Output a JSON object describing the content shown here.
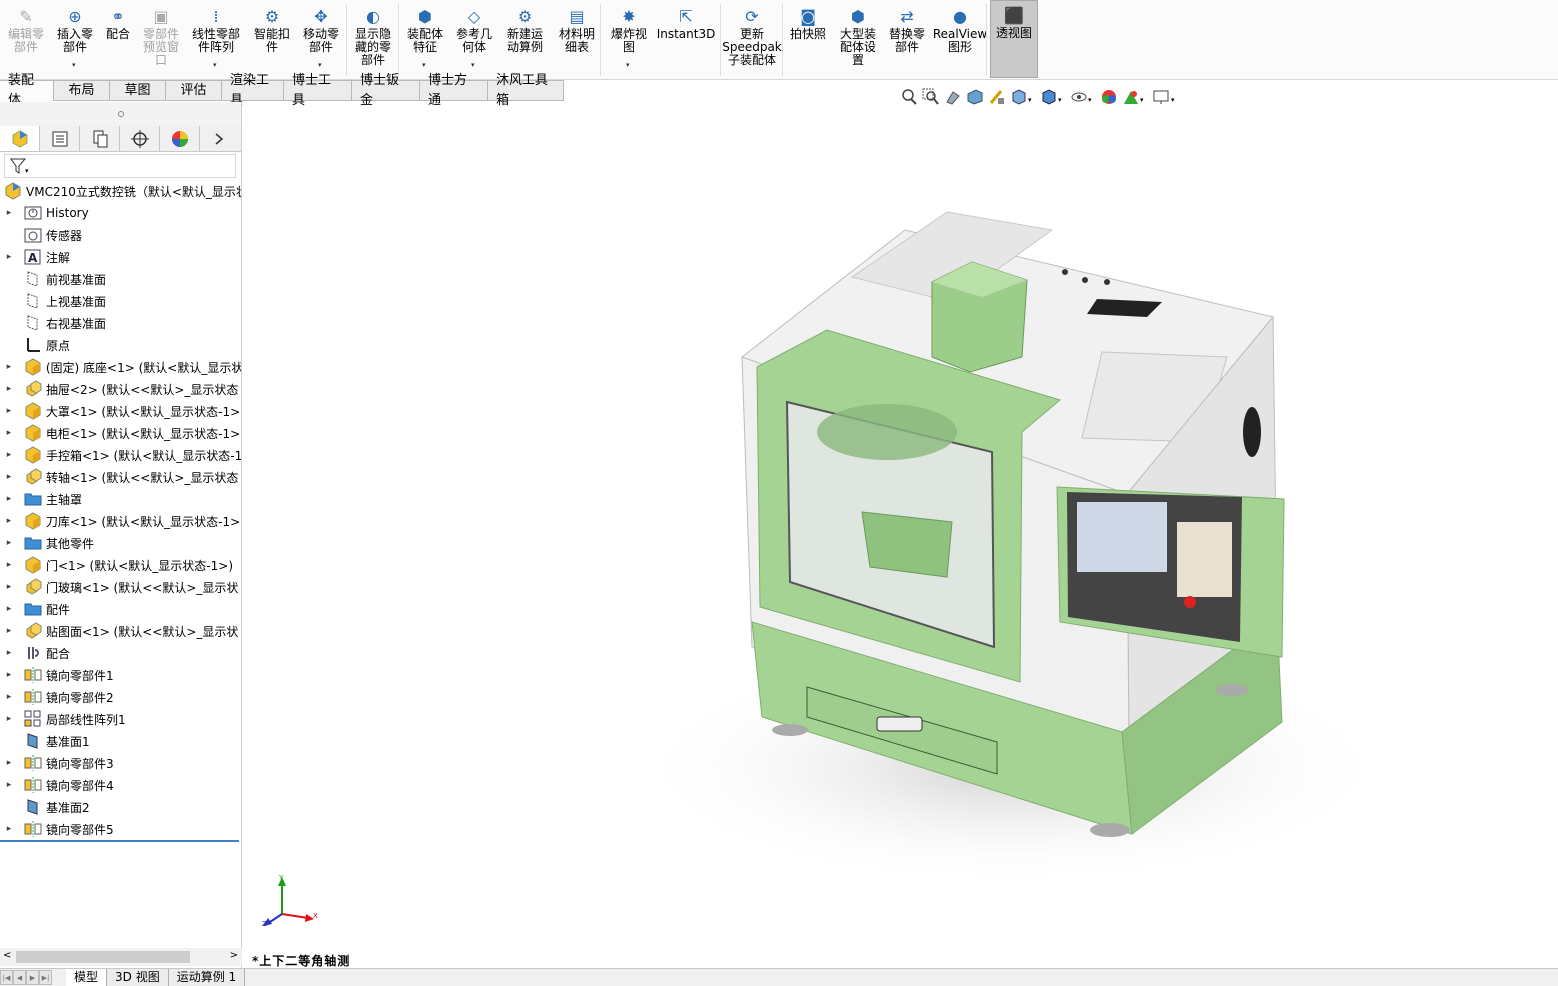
{
  "ribbon": {
    "buttons": [
      {
        "label": "编辑零\n部件",
        "disabled": true
      },
      {
        "label": "插入零\n部件",
        "arrow": true
      },
      {
        "label": "配合"
      },
      {
        "label": "零部件\n预览窗\n口",
        "disabled": true
      },
      {
        "label": "线性零部\n件阵列",
        "arrow": true
      },
      {
        "label": "智能扣\n件"
      },
      {
        "label": "移动零\n部件",
        "arrow": true
      },
      {
        "label": "显示隐\n藏的零\n部件"
      },
      {
        "label": "装配体\n特征",
        "arrow": true
      },
      {
        "label": "参考几\n何体",
        "arrow": true
      },
      {
        "label": "新建运\n动算例"
      },
      {
        "label": "材料明\n细表"
      },
      {
        "label": "爆炸视\n图",
        "arrow": true
      },
      {
        "label": "Instant3D"
      },
      {
        "label": "更新\nSpeedpak\n子装配体"
      },
      {
        "label": "拍快照"
      },
      {
        "label": "大型装\n配体设\n置"
      },
      {
        "label": "替换零\n部件"
      },
      {
        "label": "RealView\n图形"
      },
      {
        "label": "透视图",
        "active": true
      }
    ]
  },
  "tabs": [
    "装配体",
    "布局",
    "草图",
    "评估",
    "渲染工具",
    "博士工具",
    "博士钣金",
    "博士方通",
    "沐风工具箱"
  ],
  "tree": {
    "root": "VMC210立式数控铣（默认<默认_显示状",
    "items": [
      {
        "label": "History",
        "icon": "history-icon",
        "exp": true
      },
      {
        "label": "传感器",
        "icon": "sensor-icon",
        "exp": false
      },
      {
        "label": "注解",
        "icon": "annotation-icon",
        "exp": true
      },
      {
        "label": "前视基准面",
        "icon": "plane-icon",
        "exp": false
      },
      {
        "label": "上视基准面",
        "icon": "plane-icon",
        "exp": false
      },
      {
        "label": "右视基准面",
        "icon": "plane-icon",
        "exp": false
      },
      {
        "label": "原点",
        "icon": "origin-icon",
        "exp": false
      },
      {
        "label": "(固定) 底座<1> (默认<默认_显示状",
        "icon": "part-icon",
        "exp": true
      },
      {
        "label": "抽屉<2> (默认<<默认>_显示状态",
        "icon": "subassembly-icon",
        "exp": true
      },
      {
        "label": "大罩<1> (默认<默认_显示状态-1>)",
        "icon": "part-icon",
        "exp": true
      },
      {
        "label": "电柜<1> (默认<默认_显示状态-1>)",
        "icon": "part-icon",
        "exp": true
      },
      {
        "label": "手控箱<1> (默认<默认_显示状态-1",
        "icon": "part-icon",
        "exp": true
      },
      {
        "label": "转轴<1> (默认<<默认>_显示状态",
        "icon": "subassembly-icon",
        "exp": true
      },
      {
        "label": "主轴罩",
        "icon": "folder-icon",
        "exp": true
      },
      {
        "label": "刀库<1> (默认<默认_显示状态-1>)",
        "icon": "part-icon",
        "exp": true
      },
      {
        "label": "其他零件",
        "icon": "folder-icon",
        "exp": true
      },
      {
        "label": "门<1> (默认<默认_显示状态-1>)",
        "icon": "part-icon",
        "exp": true
      },
      {
        "label": "门玻璃<1> (默认<<默认>_显示状",
        "icon": "subassembly-icon",
        "exp": true
      },
      {
        "label": "配件",
        "icon": "folder-icon",
        "exp": true
      },
      {
        "label": "贴图面<1> (默认<<默认>_显示状",
        "icon": "subassembly-icon",
        "exp": true
      },
      {
        "label": "配合",
        "icon": "mates-icon",
        "exp": true
      },
      {
        "label": "镜向零部件1",
        "icon": "mirror-component-icon",
        "exp": true
      },
      {
        "label": "镜向零部件2",
        "icon": "mirror-component-icon",
        "exp": true
      },
      {
        "label": "局部线性阵列1",
        "icon": "linear-pattern-icon",
        "exp": true
      },
      {
        "label": "基准面1",
        "icon": "plane-feature-icon",
        "exp": false
      },
      {
        "label": "镜向零部件3",
        "icon": "mirror-component-icon",
        "exp": true
      },
      {
        "label": "镜向零部件4",
        "icon": "mirror-component-icon",
        "exp": true
      },
      {
        "label": "基准面2",
        "icon": "plane-feature-icon",
        "exp": false
      },
      {
        "label": "镜向零部件5",
        "icon": "mirror-component-icon",
        "exp": true
      }
    ]
  },
  "viewport": {
    "view_name": "*上下二等角轴测",
    "triad": {
      "x": "X",
      "y": "Y",
      "z": "Z"
    }
  },
  "bottom_tabs": [
    "模型",
    "3D 视图",
    "运动算例 1"
  ],
  "colors": {
    "machine_green": "#a5d394",
    "panel_white": "#eeeeee",
    "accent_blue": "#3f7fc8"
  }
}
